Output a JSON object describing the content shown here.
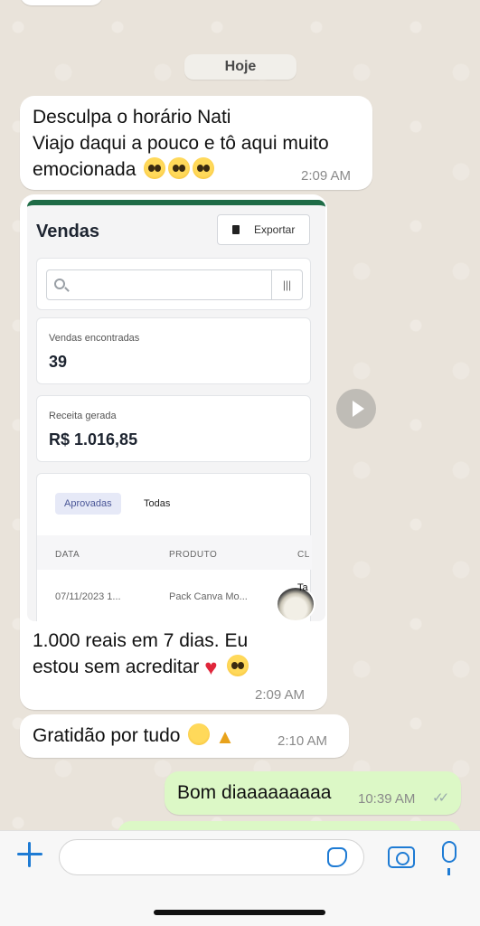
{
  "chat": {
    "date_divider": "Hoje",
    "messages": [
      {
        "line1": "Desculpa o horário Nati",
        "line2": "Viajo daqui a pouco e tô aqui muito",
        "line3": "emocionada",
        "time": "2:09 AM"
      },
      {
        "caption_line1": "1.000 reais em 7 dias. Eu",
        "caption_line2": "estou sem acreditar",
        "time": "2:09 AM"
      },
      {
        "text": "Gratidão por tudo",
        "time": "2:10 AM"
      },
      {
        "text": "Bom diaaaaaaaaa",
        "time": "10:39 AM"
      }
    ]
  },
  "screenshot": {
    "title": "Vendas",
    "export_label": "Exportar",
    "vendas_label": "Vendas encontradas",
    "vendas_value": "39",
    "receita_label": "Receita gerada",
    "receita_value": "R$ 1.016,85",
    "tab_active": "Aprovadas",
    "tab_other": "Todas",
    "columns": [
      "DATA",
      "PRODUTO",
      "CL"
    ],
    "row": [
      "07/11/2023 1...",
      "Pack Canva Mo..."
    ],
    "avatar_tag": "Ta"
  },
  "input": {
    "placeholder": ""
  },
  "colors": {
    "accent": "#1e7bd4",
    "outgoing_bubble": "#dcf8c6",
    "incoming_bubble": "#ffffff",
    "header_bar": "#1e6b46"
  }
}
